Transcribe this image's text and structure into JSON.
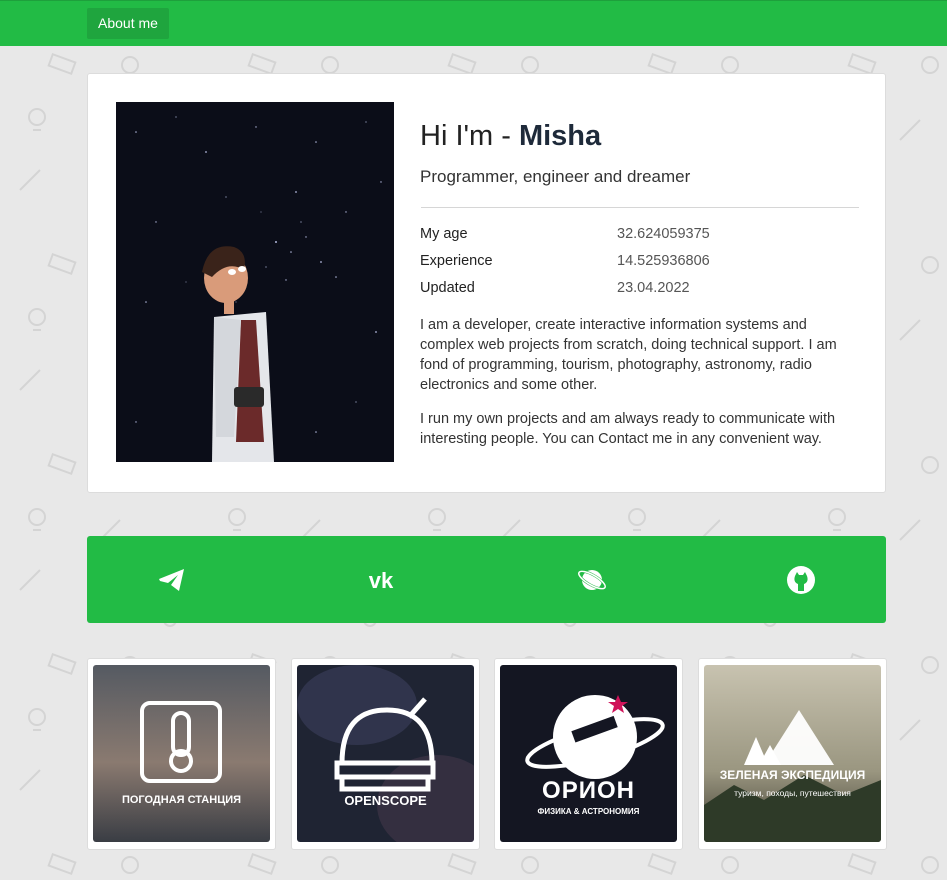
{
  "nav": {
    "about_label": "About me"
  },
  "profile": {
    "greeting": "Hi I'm - ",
    "name": "Misha",
    "tagline": "Programmer, engineer and dreamer",
    "facts": [
      {
        "label": "My age",
        "value": "32.624059375"
      },
      {
        "label": "Experience",
        "value": "14.525936806"
      },
      {
        "label": "Updated",
        "value": "23.04.2022"
      }
    ],
    "bio": [
      "I am a developer, create interactive information systems and complex web projects from scratch, doing technical support. I am fond of programming, tourism, photography, astronomy, radio electronics and some other.",
      "I run my own projects and am always ready to communicate with interesting people. You can Contact me in any convenient way."
    ]
  },
  "social": [
    {
      "icon": "telegram-icon"
    },
    {
      "icon": "vk-icon"
    },
    {
      "icon": "planet-icon"
    },
    {
      "icon": "github-icon"
    }
  ],
  "projects": [
    {
      "caption": "ПОГОДНАЯ СТАНЦИЯ",
      "icon": "thermometer-icon"
    },
    {
      "caption": "OPENSCOPE",
      "icon": "observatory-icon"
    },
    {
      "caption": "ОРИОН",
      "subcaption": "ФИЗИКА & АСТРОНОМИЯ",
      "icon": "telescope-planet-icon"
    },
    {
      "caption": "ЗЕЛЕНАЯ ЭКСПЕДИЦИЯ",
      "subcaption": "туризм, походы, путешествия",
      "icon": "mountains-icon"
    }
  ],
  "colors": {
    "accent": "#22bb45",
    "background": "#e8e8e8"
  }
}
